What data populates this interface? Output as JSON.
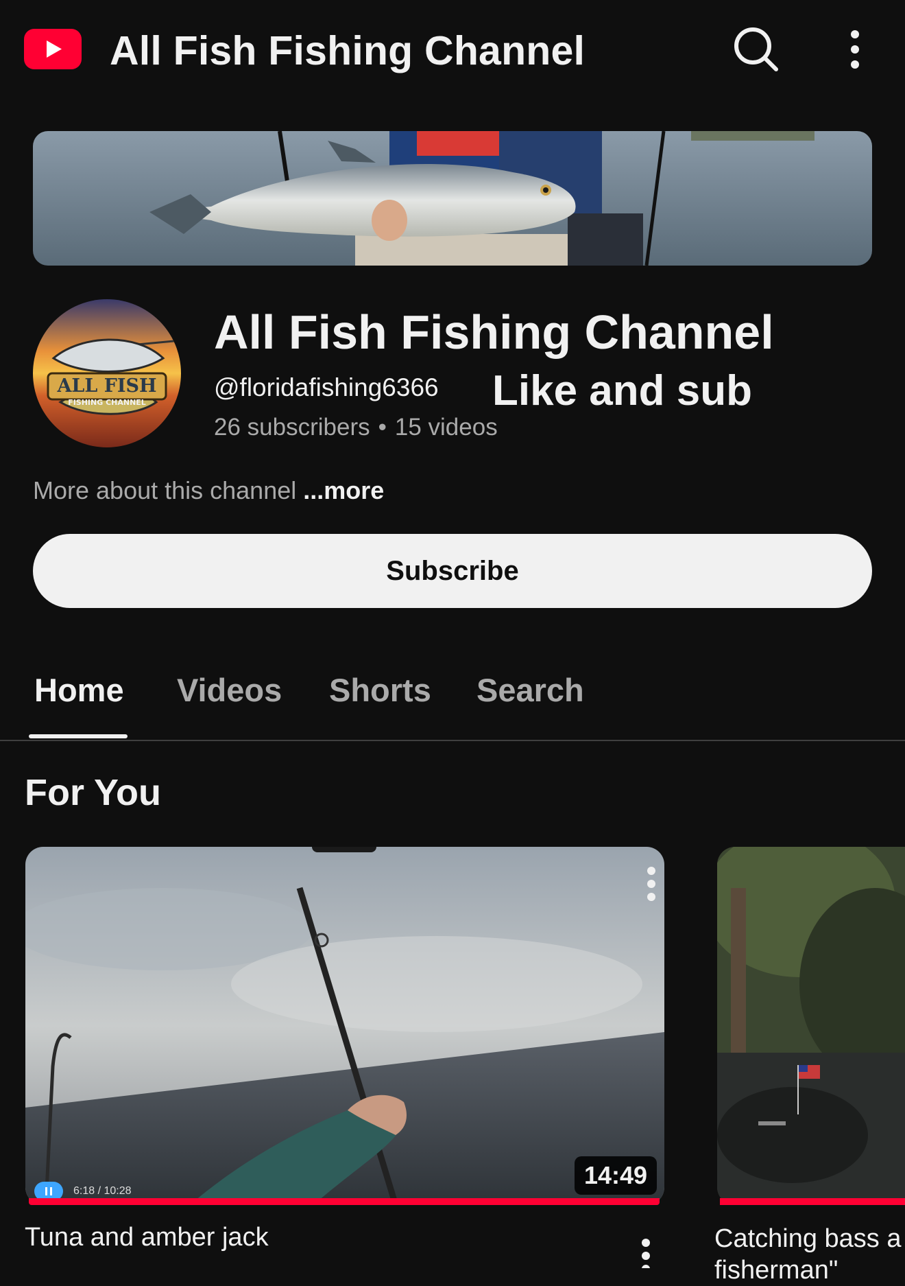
{
  "app_bar": {
    "title": "All Fish Fishing Channel",
    "logo_icon": "youtube-logo-icon",
    "search_icon": "search-icon",
    "more_icon": "more-vert-icon",
    "brand_color": "#ff0033"
  },
  "channel": {
    "name": "All Fish Fishing Channel",
    "handle": "@floridafishing6366",
    "promo_text": "Like and sub",
    "subscribers": "26 subscribers",
    "videos": "15 videos",
    "separator": "•",
    "about": "More about this channel",
    "more_link": "...more",
    "subscribe_label": "Subscribe",
    "avatar_text": "ALL FISH",
    "avatar_subtext": "FISHING CHANNEL"
  },
  "tabs": [
    {
      "label": "Home",
      "active": true
    },
    {
      "label": "Videos",
      "active": false
    },
    {
      "label": "Shorts",
      "active": false
    },
    {
      "label": "Search",
      "active": false
    }
  ],
  "section": {
    "title": "For You"
  },
  "videos": [
    {
      "title": "Tuna and amber jack",
      "duration": "14:49",
      "playback_time": "6:18 / 10:28",
      "watched_progress": 1.0
    },
    {
      "title_line1": "Catching bass a",
      "title_line2": "fisherman\"",
      "watched_progress": 1.0
    }
  ]
}
